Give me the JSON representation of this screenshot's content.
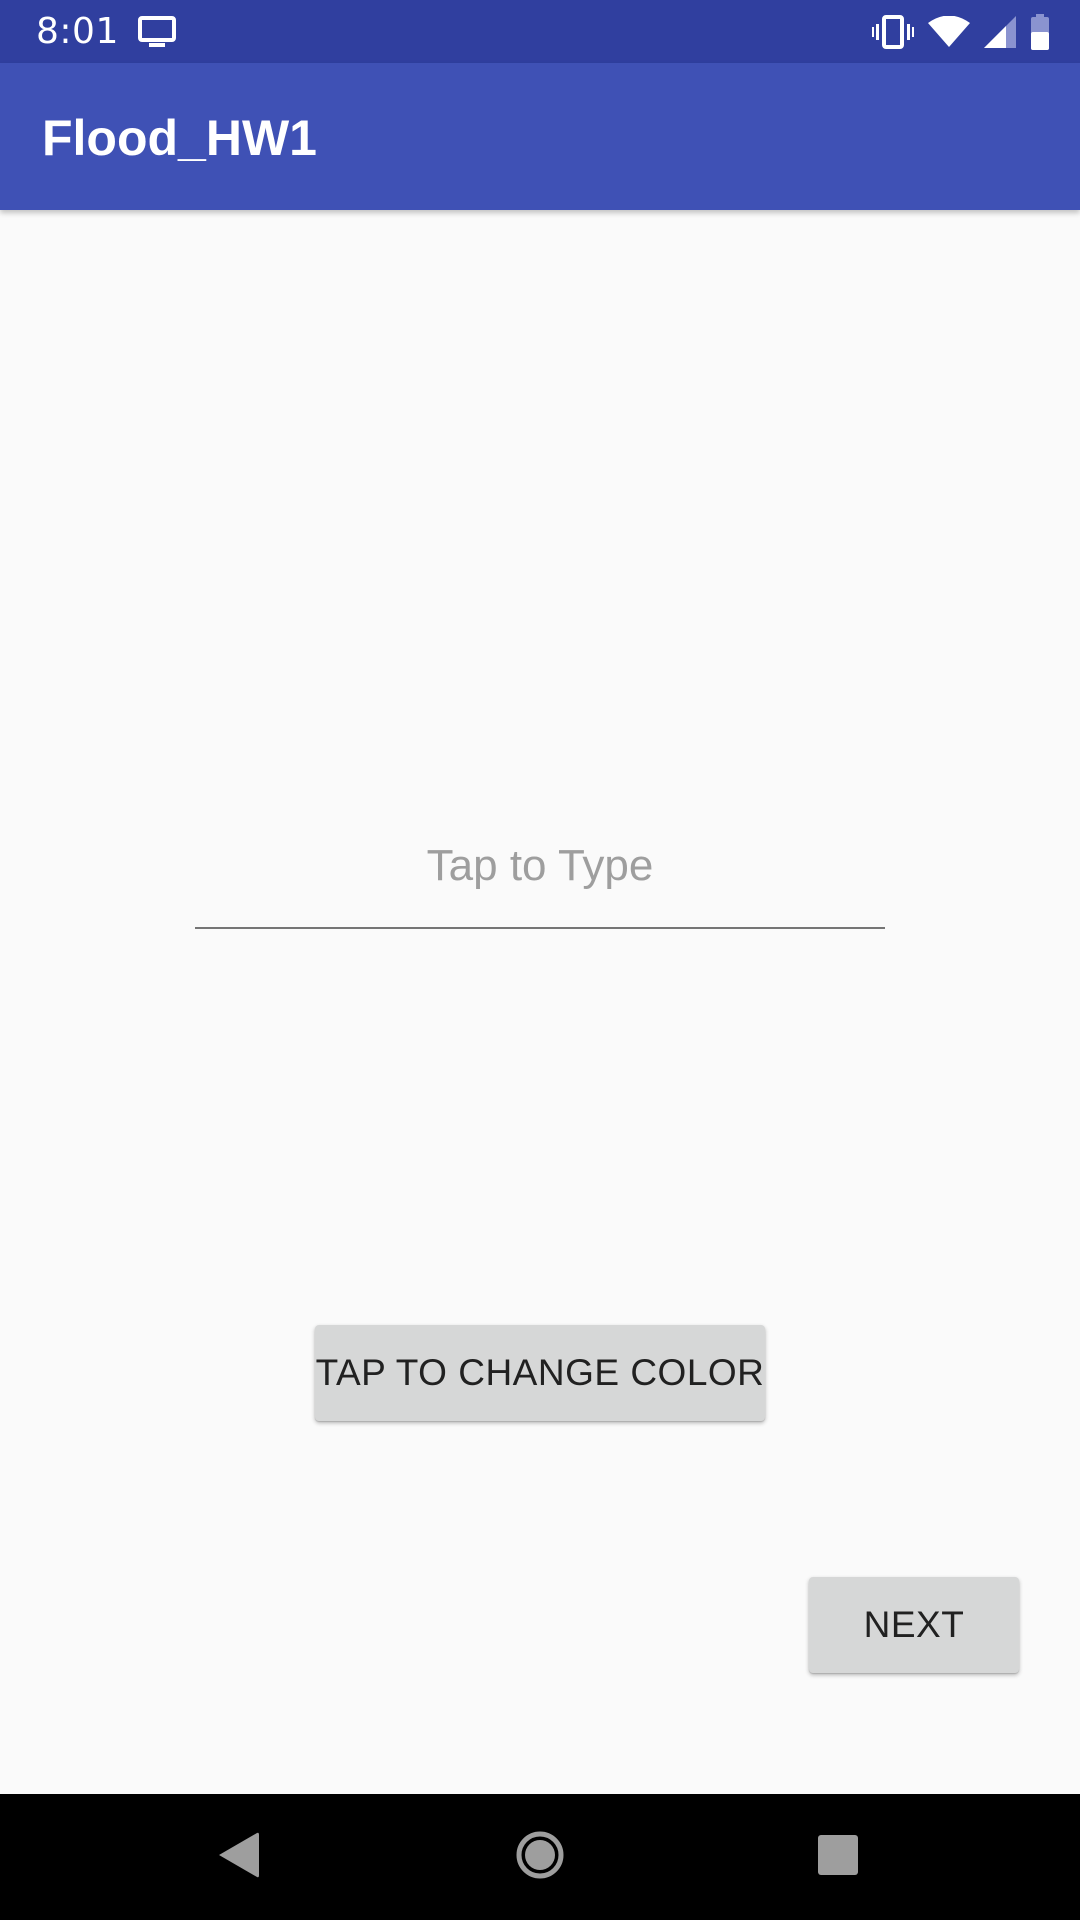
{
  "status_bar": {
    "time": "8:01",
    "icons": [
      "cast-icon",
      "vibrate-icon",
      "wifi-icon",
      "signal-icon",
      "battery-icon"
    ]
  },
  "app_bar": {
    "title": "Flood_HW1",
    "color": "#3f51b5"
  },
  "colors": {
    "status_bar": "#303f9f",
    "background": "#fafafa",
    "button": "#d6d7d7"
  },
  "main": {
    "text_field": {
      "value": "",
      "placeholder": "Tap to Type"
    },
    "change_color_button": "TAP TO CHANGE COLOR",
    "next_button": "NEXT"
  },
  "nav_bar": {
    "icons": [
      "back-icon",
      "home-icon",
      "recents-icon"
    ]
  }
}
